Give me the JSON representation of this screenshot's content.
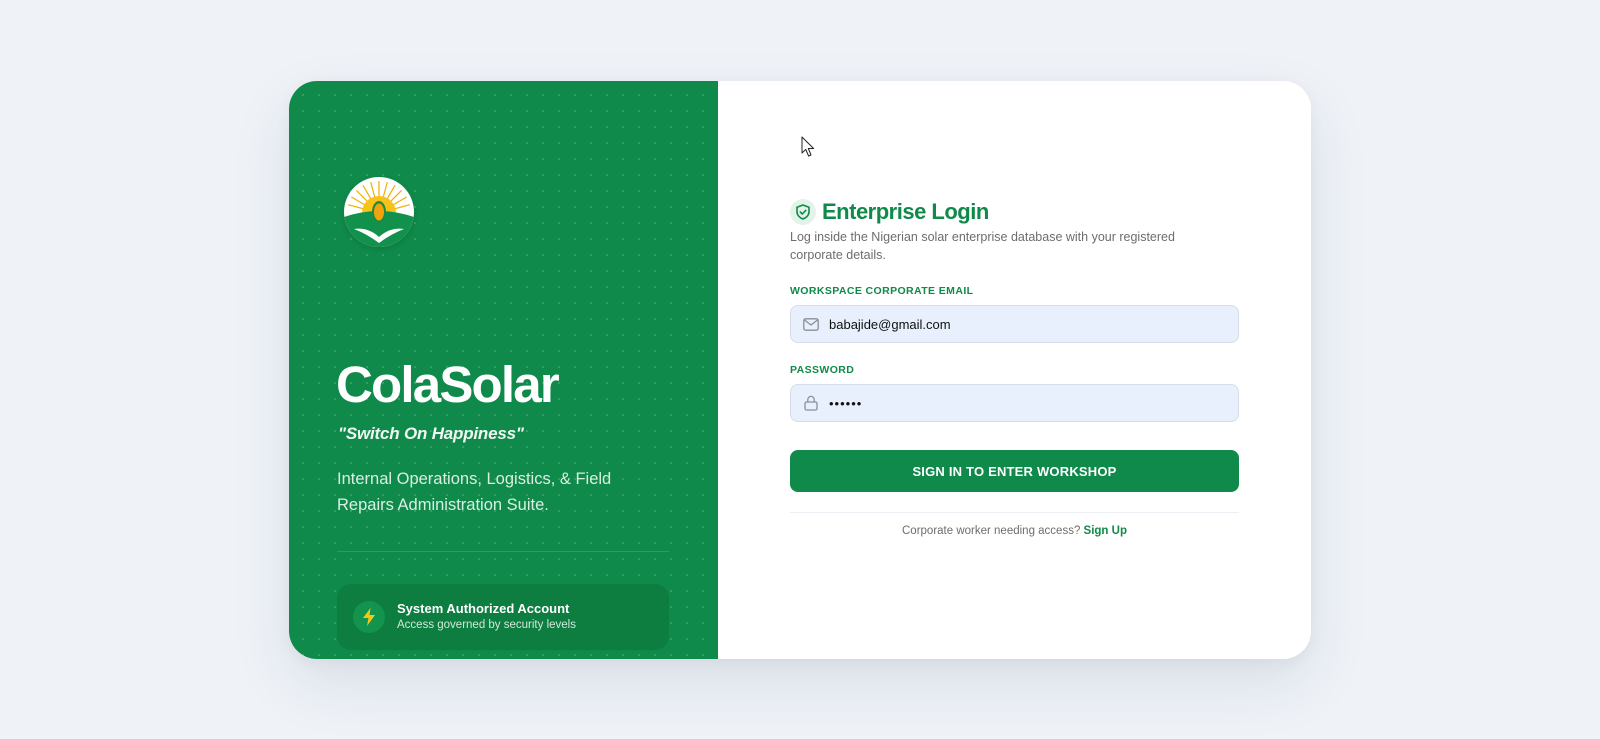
{
  "brand": {
    "name": "ColaSolar",
    "tagline": "\"Switch On Happiness\"",
    "description": "Internal Operations, Logistics, & Field Repairs Administration Suite.",
    "auth_title": "System Authorized Account",
    "auth_subtitle": "Access governed by security levels",
    "auth_icon": "lightning-bolt-icon",
    "logo_icon": "sun-and-kola-nut-logo"
  },
  "login": {
    "title": "Enterprise Login",
    "title_icon": "shield-check-icon",
    "subtitle": "Log inside the Nigerian solar enterprise database with your registered corporate details.",
    "email_label": "WORKSPACE CORPORATE EMAIL",
    "email_value": "babajide@gmail.com",
    "email_icon": "mail-icon",
    "password_label": "PASSWORD",
    "password_value": "••••••",
    "password_icon": "lock-icon",
    "submit_label": "SIGN IN TO ENTER WORKSHOP",
    "signup_prompt": "Corporate worker needing access?",
    "signup_link": "Sign Up"
  },
  "colors": {
    "brand_green": "#0f8a4a",
    "page_background": "#eff3f8",
    "input_background": "#e8f0fd",
    "accent_gold": "#f5b400"
  }
}
